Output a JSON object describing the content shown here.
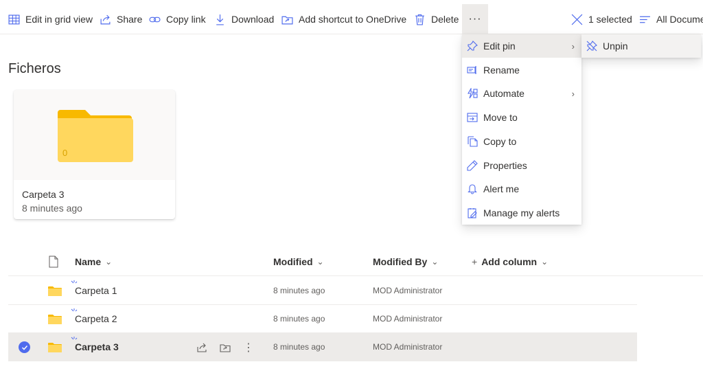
{
  "toolbar": {
    "edit_grid": "Edit in grid view",
    "share": "Share",
    "copy_link": "Copy link",
    "download": "Download",
    "add_shortcut": "Add shortcut to OneDrive",
    "delete": "Delete",
    "more": "···",
    "selected": "1 selected",
    "view": "All Documents"
  },
  "section_title": "Ficheros",
  "tile": {
    "name": "Carpeta 3",
    "meta": "8 minutes ago",
    "count": "0"
  },
  "list": {
    "columns": {
      "name": "Name",
      "modified": "Modified",
      "modified_by": "Modified By",
      "add_column": "Add column"
    },
    "rows": [
      {
        "name": "Carpeta 1",
        "modified": "8 minutes ago",
        "modified_by": "MOD Administrator"
      },
      {
        "name": "Carpeta 2",
        "modified": "8 minutes ago",
        "modified_by": "MOD Administrator"
      },
      {
        "name": "Carpeta 3",
        "modified": "8 minutes ago",
        "modified_by": "MOD Administrator"
      }
    ]
  },
  "menu": {
    "items": [
      {
        "label": "Edit pin",
        "icon": "pin-icon"
      },
      {
        "label": "Rename",
        "icon": "rename-icon"
      },
      {
        "label": "Automate",
        "icon": "automate-icon"
      },
      {
        "label": "Move to",
        "icon": "move-icon"
      },
      {
        "label": "Copy to",
        "icon": "copy-icon"
      },
      {
        "label": "Properties",
        "icon": "pencil-icon"
      },
      {
        "label": "Alert me",
        "icon": "bell-icon"
      },
      {
        "label": "Manage my alerts",
        "icon": "manage-alerts-icon"
      }
    ],
    "submenu": {
      "unpin": "Unpin"
    }
  },
  "colors": {
    "accent": "#4f6bed",
    "folder": "#ffd75e",
    "folder_dark": "#f8b900"
  }
}
